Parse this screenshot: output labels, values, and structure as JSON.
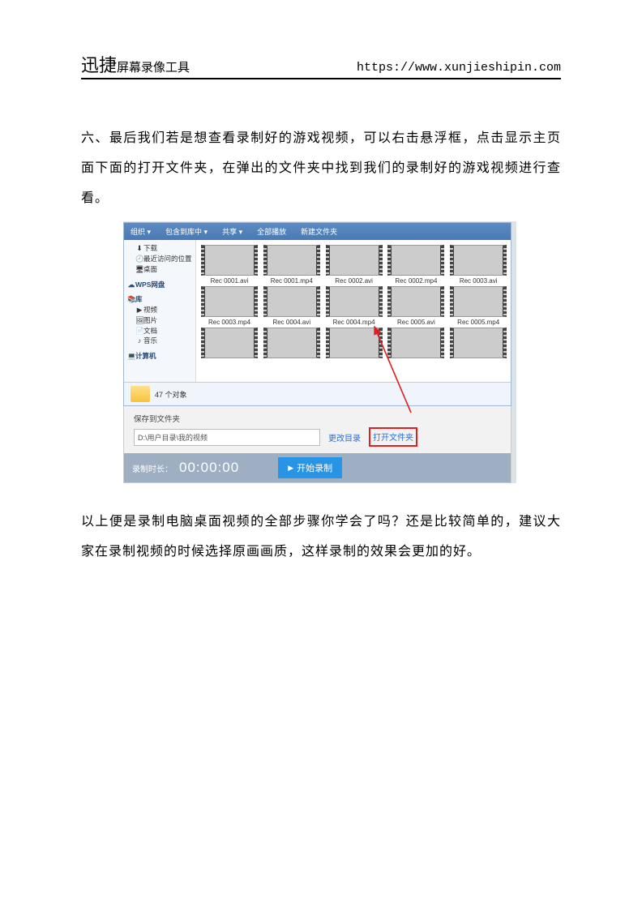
{
  "header": {
    "title_big": "迅捷",
    "title_rest": "屏幕录像工具",
    "url": "https://www.xunjieshipin.com"
  },
  "body": {
    "para1": "六、最后我们若是想查看录制好的游戏视频，可以右击悬浮框，点击显示主页面下面的打开文件夹，在弹出的文件夹中找到我们的录制好的游戏视频进行查看。",
    "para2": "以上便是录制电脑桌面视频的全部步骤你学会了吗？还是比较简单的，建议大家在录制视频的时候选择原画画质，这样录制的效果会更加的好。"
  },
  "explorer": {
    "toolbar": [
      "组织 ▾",
      "包含到库中 ▾",
      "共享 ▾",
      "全部播放",
      "新建文件夹"
    ],
    "sidebar": {
      "downloads": "下载",
      "recent": "最近访问的位置",
      "desktop": "桌面",
      "wps": "WPS网盘",
      "library": "库",
      "video": "视频",
      "picture": "图片",
      "document": "文档",
      "music": "音乐",
      "computer": "计算机"
    },
    "files": [
      "Rec 0001.avi",
      "Rec 0001.mp4",
      "Rec 0002.avi",
      "Rec 0002.mp4",
      "Rec 0003.avi",
      "Rec 0003.mp4",
      "Rec 0004.avi",
      "Rec 0004.mp4",
      "Rec 0005.avi",
      "Rec 0005.mp4",
      "",
      "",
      "",
      "",
      ""
    ],
    "status": "47 个对象"
  },
  "app": {
    "save_label": "保存到文件夹",
    "path": "D:\\用户目录\\我的视频",
    "change_dir": "更改目录",
    "open_folder": "打开文件夹",
    "rec_label": "录制时长：",
    "rec_time": "00:00:00",
    "rec_btn": "开始录制"
  }
}
